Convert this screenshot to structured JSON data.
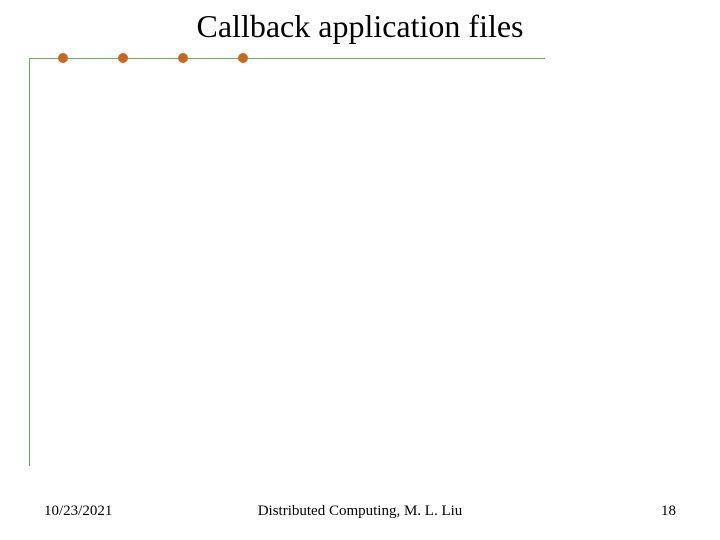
{
  "title": "Callback application files",
  "footer": {
    "date": "10/23/2021",
    "center": "Distributed Computing, M. L. Liu",
    "page": "18"
  }
}
